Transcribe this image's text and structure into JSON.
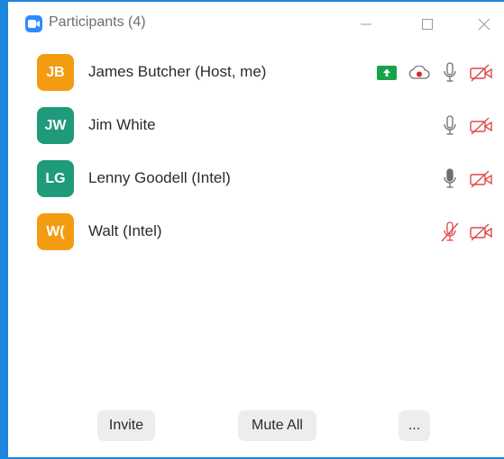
{
  "window": {
    "title": "Participants (4)"
  },
  "participants": [
    {
      "initials": "JB",
      "name": "James Butcher (Host, me)",
      "avatar_color": "#f39c12"
    },
    {
      "initials": "JW",
      "name": "Jim White",
      "avatar_color": "#1f9a7b"
    },
    {
      "initials": "LG",
      "name": "Lenny Goodell (Intel)",
      "avatar_color": "#1f9a7b"
    },
    {
      "initials": "W(",
      "name": "Walt (Intel)",
      "avatar_color": "#f39c12"
    }
  ],
  "footer": {
    "invite_label": "Invite",
    "mute_all_label": "Mute All",
    "more_label": "..."
  },
  "colors": {
    "accent": "#1e86dd",
    "share_green": "#17a34a",
    "muted_red": "#e04848"
  }
}
